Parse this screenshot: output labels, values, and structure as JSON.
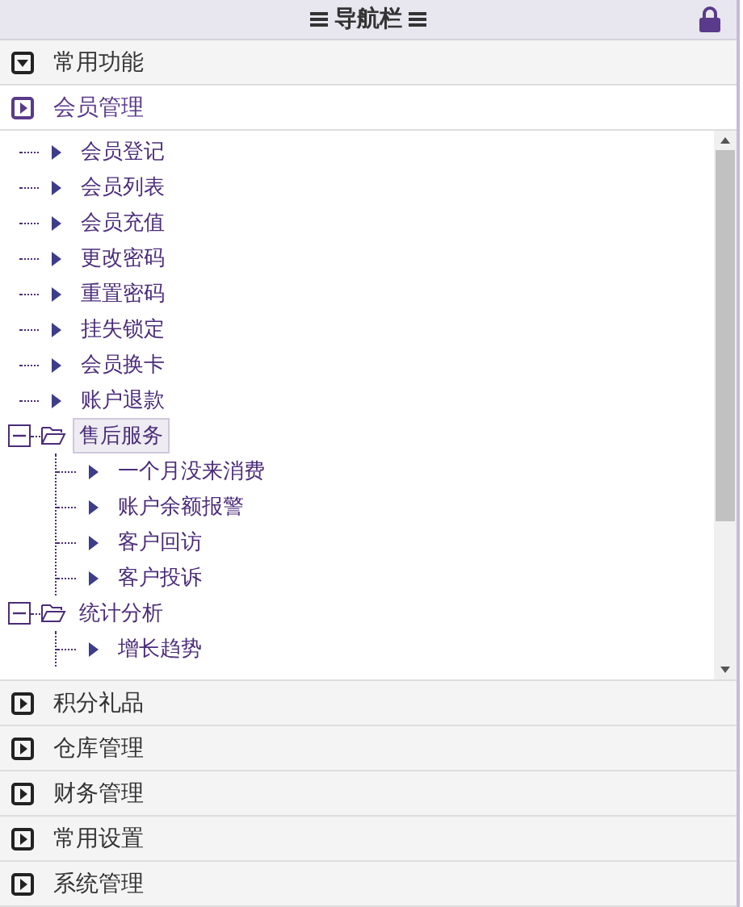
{
  "header": {
    "title": "导航栏",
    "locked": true
  },
  "sections": [
    {
      "title": "常用功能",
      "expanded": false,
      "kind": "down"
    },
    {
      "title": "会员管理",
      "expanded": true,
      "kind": "right",
      "tree": [
        {
          "label": "会员登记",
          "selected": false
        },
        {
          "label": "会员列表",
          "selected": false
        },
        {
          "label": "会员充值",
          "selected": false
        },
        {
          "label": "更改密码",
          "selected": false
        },
        {
          "label": "重置密码",
          "selected": false
        },
        {
          "label": "挂失锁定",
          "selected": false
        },
        {
          "label": "会员换卡",
          "selected": false
        },
        {
          "label": "账户退款",
          "selected": false
        },
        {
          "label": "售后服务",
          "selected": true,
          "expanded": true,
          "children": [
            {
              "label": "一个月没来消费",
              "selected": false
            },
            {
              "label": "账户余额报警",
              "selected": false
            },
            {
              "label": "客户回访",
              "selected": false
            },
            {
              "label": "客户投诉",
              "selected": false
            }
          ]
        },
        {
          "label": "统计分析",
          "selected": false,
          "expanded": true,
          "children": [
            {
              "label": "增长趋势",
              "selected": false
            }
          ]
        }
      ]
    },
    {
      "title": "积分礼品",
      "expanded": false,
      "kind": "right"
    },
    {
      "title": "仓库管理",
      "expanded": false,
      "kind": "right"
    },
    {
      "title": "财务管理",
      "expanded": false,
      "kind": "right"
    },
    {
      "title": "常用设置",
      "expanded": false,
      "kind": "right"
    },
    {
      "title": "系统管理",
      "expanded": false,
      "kind": "right"
    }
  ]
}
